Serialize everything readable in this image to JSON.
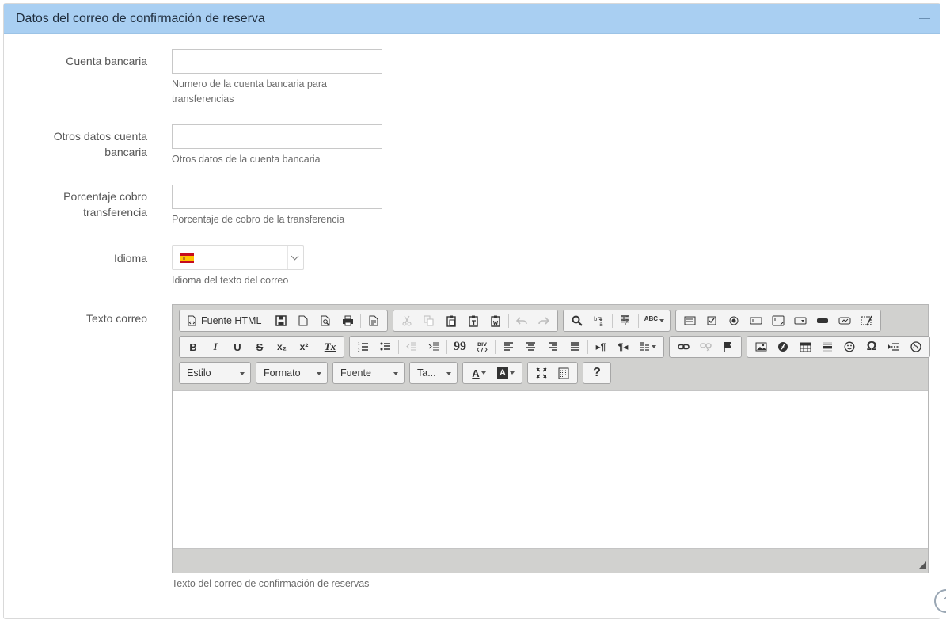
{
  "panel": {
    "title": "Datos del correo de confirmación de reserva",
    "collapse_icon": "minus-icon"
  },
  "fields": {
    "cuenta_bancaria": {
      "label": "Cuenta bancaria",
      "value": "",
      "help": "Numero de la cuenta bancaria para transferencias"
    },
    "otros_datos": {
      "label": "Otros datos cuenta bancaria",
      "value": "",
      "help": "Otros datos de la cuenta bancaria"
    },
    "porcentaje": {
      "label": "Porcentaje cobro transferencia",
      "value": "",
      "help": "Porcentaje de cobro de la transferencia"
    },
    "idioma": {
      "label": "Idioma",
      "selected_icon": "spain-flag-icon",
      "help": "Idioma del texto del correo"
    },
    "texto_correo": {
      "label": "Texto correo",
      "help": "Texto del correo de confirmación de reservas"
    }
  },
  "editor": {
    "source_label": "Fuente HTML",
    "combos": {
      "style": "Estilo",
      "format": "Formato",
      "font": "Fuente",
      "size": "Ta..."
    },
    "glyphs": {
      "bold": "B",
      "italic": "I",
      "underline": "U",
      "strike": "S",
      "subscript": "x₂",
      "superscript": "x²",
      "remove_format": "Tx",
      "blockquote": "99",
      "ltr": "▸¶",
      "rtl": "¶◂",
      "omega": "Ω",
      "help": "?",
      "spell": "ABC",
      "text_color": "A",
      "bg_color": "A"
    },
    "colors": {
      "toolbar_bg": "#d1d1cf",
      "button_bg": "#f4f4f4"
    }
  },
  "theme": {
    "header_bg": "#a9cff2"
  }
}
